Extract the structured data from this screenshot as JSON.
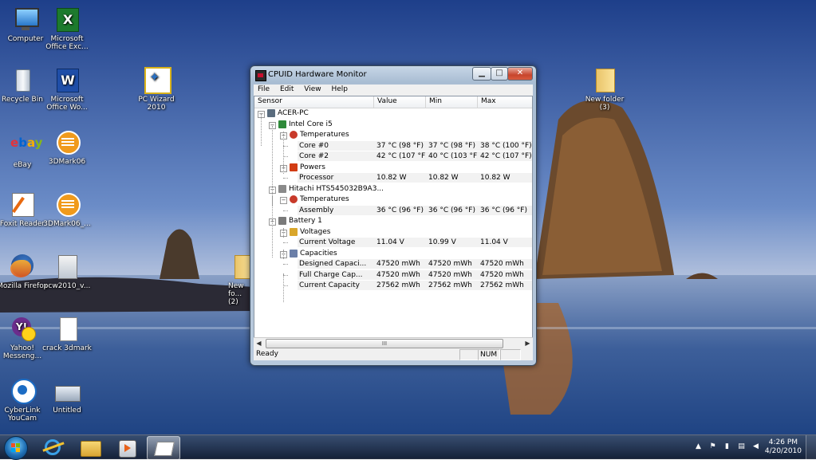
{
  "desktop": {
    "icons": [
      {
        "label": "Computer",
        "icon": "computer-icon"
      },
      {
        "label": "Microsoft Office Exc...",
        "icon": "excel-icon"
      },
      {
        "label": "Recycle Bin",
        "icon": "recycle-bin-icon"
      },
      {
        "label": "Microsoft Office Wo...",
        "icon": "word-icon"
      },
      {
        "label": "PC Wizard 2010",
        "icon": "pc-wizard-icon"
      },
      {
        "label": "eBay",
        "icon": "ebay-icon"
      },
      {
        "label": "3DMark06",
        "icon": "3dmark-icon"
      },
      {
        "label": "Foxit Reader",
        "icon": "foxit-icon"
      },
      {
        "label": "3DMark06_...",
        "icon": "3dmark-icon"
      },
      {
        "label": "Mozilla Firefox",
        "icon": "firefox-icon"
      },
      {
        "label": "pcw2010_v...",
        "icon": "installer-icon"
      },
      {
        "label": "Yahoo! Messeng...",
        "icon": "yahoo-messenger-icon"
      },
      {
        "label": "crack 3dmark",
        "icon": "text-file-icon"
      },
      {
        "label": "CyberLink YouCam",
        "icon": "youcam-icon"
      },
      {
        "label": "Untitled",
        "icon": "image-file-icon"
      },
      {
        "label": "New folder (3)",
        "icon": "folder-icon"
      },
      {
        "label": "New fo... (2)",
        "icon": "folder-icon"
      }
    ]
  },
  "window": {
    "title": "CPUID Hardware Monitor",
    "buttons": {
      "minimize": "▁",
      "maximize": "□",
      "close": "✕"
    },
    "menu": [
      "File",
      "Edit",
      "View",
      "Help"
    ],
    "columns": [
      "Sensor",
      "Value",
      "Min",
      "Max"
    ],
    "rows": [
      {
        "label": "ACER-PC",
        "value": "",
        "min": "",
        "max": ""
      },
      {
        "label": "Intel Core i5",
        "value": "",
        "min": "",
        "max": ""
      },
      {
        "label": "Temperatures",
        "value": "",
        "min": "",
        "max": ""
      },
      {
        "label": "Core #0",
        "value": "37 °C  (98 °F)",
        "min": "37 °C  (98 °F)",
        "max": "38 °C  (100 °F)"
      },
      {
        "label": "Core #2",
        "value": "42 °C  (107 °F)",
        "min": "40 °C  (103 °F)",
        "max": "42 °C  (107 °F)"
      },
      {
        "label": "Powers",
        "value": "",
        "min": "",
        "max": ""
      },
      {
        "label": "Processor",
        "value": "10.82 W",
        "min": "10.82 W",
        "max": "10.82 W"
      },
      {
        "label": "Hitachi HTS545032B9A3...",
        "value": "",
        "min": "",
        "max": ""
      },
      {
        "label": "Temperatures",
        "value": "",
        "min": "",
        "max": ""
      },
      {
        "label": "Assembly",
        "value": "36 °C  (96 °F)",
        "min": "36 °C  (96 °F)",
        "max": "36 °C  (96 °F)"
      },
      {
        "label": "Battery 1",
        "value": "",
        "min": "",
        "max": ""
      },
      {
        "label": "Voltages",
        "value": "",
        "min": "",
        "max": ""
      },
      {
        "label": "Current Voltage",
        "value": "11.04 V",
        "min": "10.99 V",
        "max": "11.04 V"
      },
      {
        "label": "Capacities",
        "value": "",
        "min": "",
        "max": ""
      },
      {
        "label": "Designed Capaci...",
        "value": "47520 mWh",
        "min": "47520 mWh",
        "max": "47520 mWh"
      },
      {
        "label": "Full Charge Cap...",
        "value": "47520 mWh",
        "min": "47520 mWh",
        "max": "47520 mWh"
      },
      {
        "label": "Current Capacity",
        "value": "27562 mWh",
        "min": "27562 mWh",
        "max": "27562 mWh"
      }
    ],
    "status": {
      "text": "Ready",
      "num": "NUM"
    },
    "scroll_grip": "III"
  },
  "taskbar": {
    "clock_time": "4:26 PM",
    "clock_date": "4/20/2010",
    "pinned": [
      "internet-explorer-icon",
      "windows-explorer-icon",
      "media-player-icon",
      "pc-wizard-icon"
    ]
  }
}
